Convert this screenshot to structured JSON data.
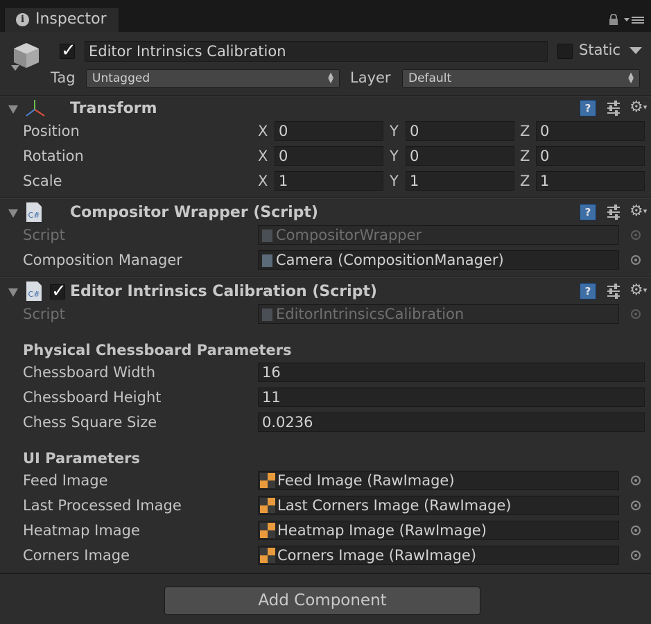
{
  "tab": {
    "label": "Inspector"
  },
  "gameobject": {
    "name": "Editor Intrinsics Calibration",
    "active": true,
    "static_label": "Static",
    "tag_label": "Tag",
    "tag_value": "Untagged",
    "layer_label": "Layer",
    "layer_value": "Default"
  },
  "transform": {
    "title": "Transform",
    "rows": [
      {
        "label": "Position",
        "x": "0",
        "y": "0",
        "z": "0"
      },
      {
        "label": "Rotation",
        "x": "0",
        "y": "0",
        "z": "0"
      },
      {
        "label": "Scale",
        "x": "1",
        "y": "1",
        "z": "1"
      }
    ],
    "axis_x": "X",
    "axis_y": "Y",
    "axis_z": "Z"
  },
  "compositor": {
    "title": "Compositor Wrapper (Script)",
    "script_label": "Script",
    "script_value": "CompositorWrapper",
    "manager_label": "Composition Manager",
    "manager_value": "Camera (CompositionManager)"
  },
  "calibration": {
    "title": "Editor Intrinsics Calibration (Script)",
    "enabled": true,
    "script_label": "Script",
    "script_value": "EditorIntrinsicsCalibration",
    "section1": "Physical Chessboard Parameters",
    "width_label": "Chessboard Width",
    "width_value": "16",
    "height_label": "Chessboard Height",
    "height_value": "11",
    "square_label": "Chess Square Size",
    "square_value": "0.0236",
    "section2": "UI Parameters",
    "feed_label": "Feed Image",
    "feed_value": "Feed Image (RawImage)",
    "last_label": "Last Processed Image",
    "last_value": "Last Corners Image (RawImage)",
    "heatmap_label": "Heatmap Image",
    "heatmap_value": "Heatmap Image (RawImage)",
    "corners_label": "Corners Image",
    "corners_value": "Corners Image (RawImage)"
  },
  "add_component_label": "Add Component",
  "cs_icon_text": "C#",
  "colors": {
    "background": "#2d2d2d",
    "help": "#3d6fa6",
    "tab_bar": "#191919"
  }
}
